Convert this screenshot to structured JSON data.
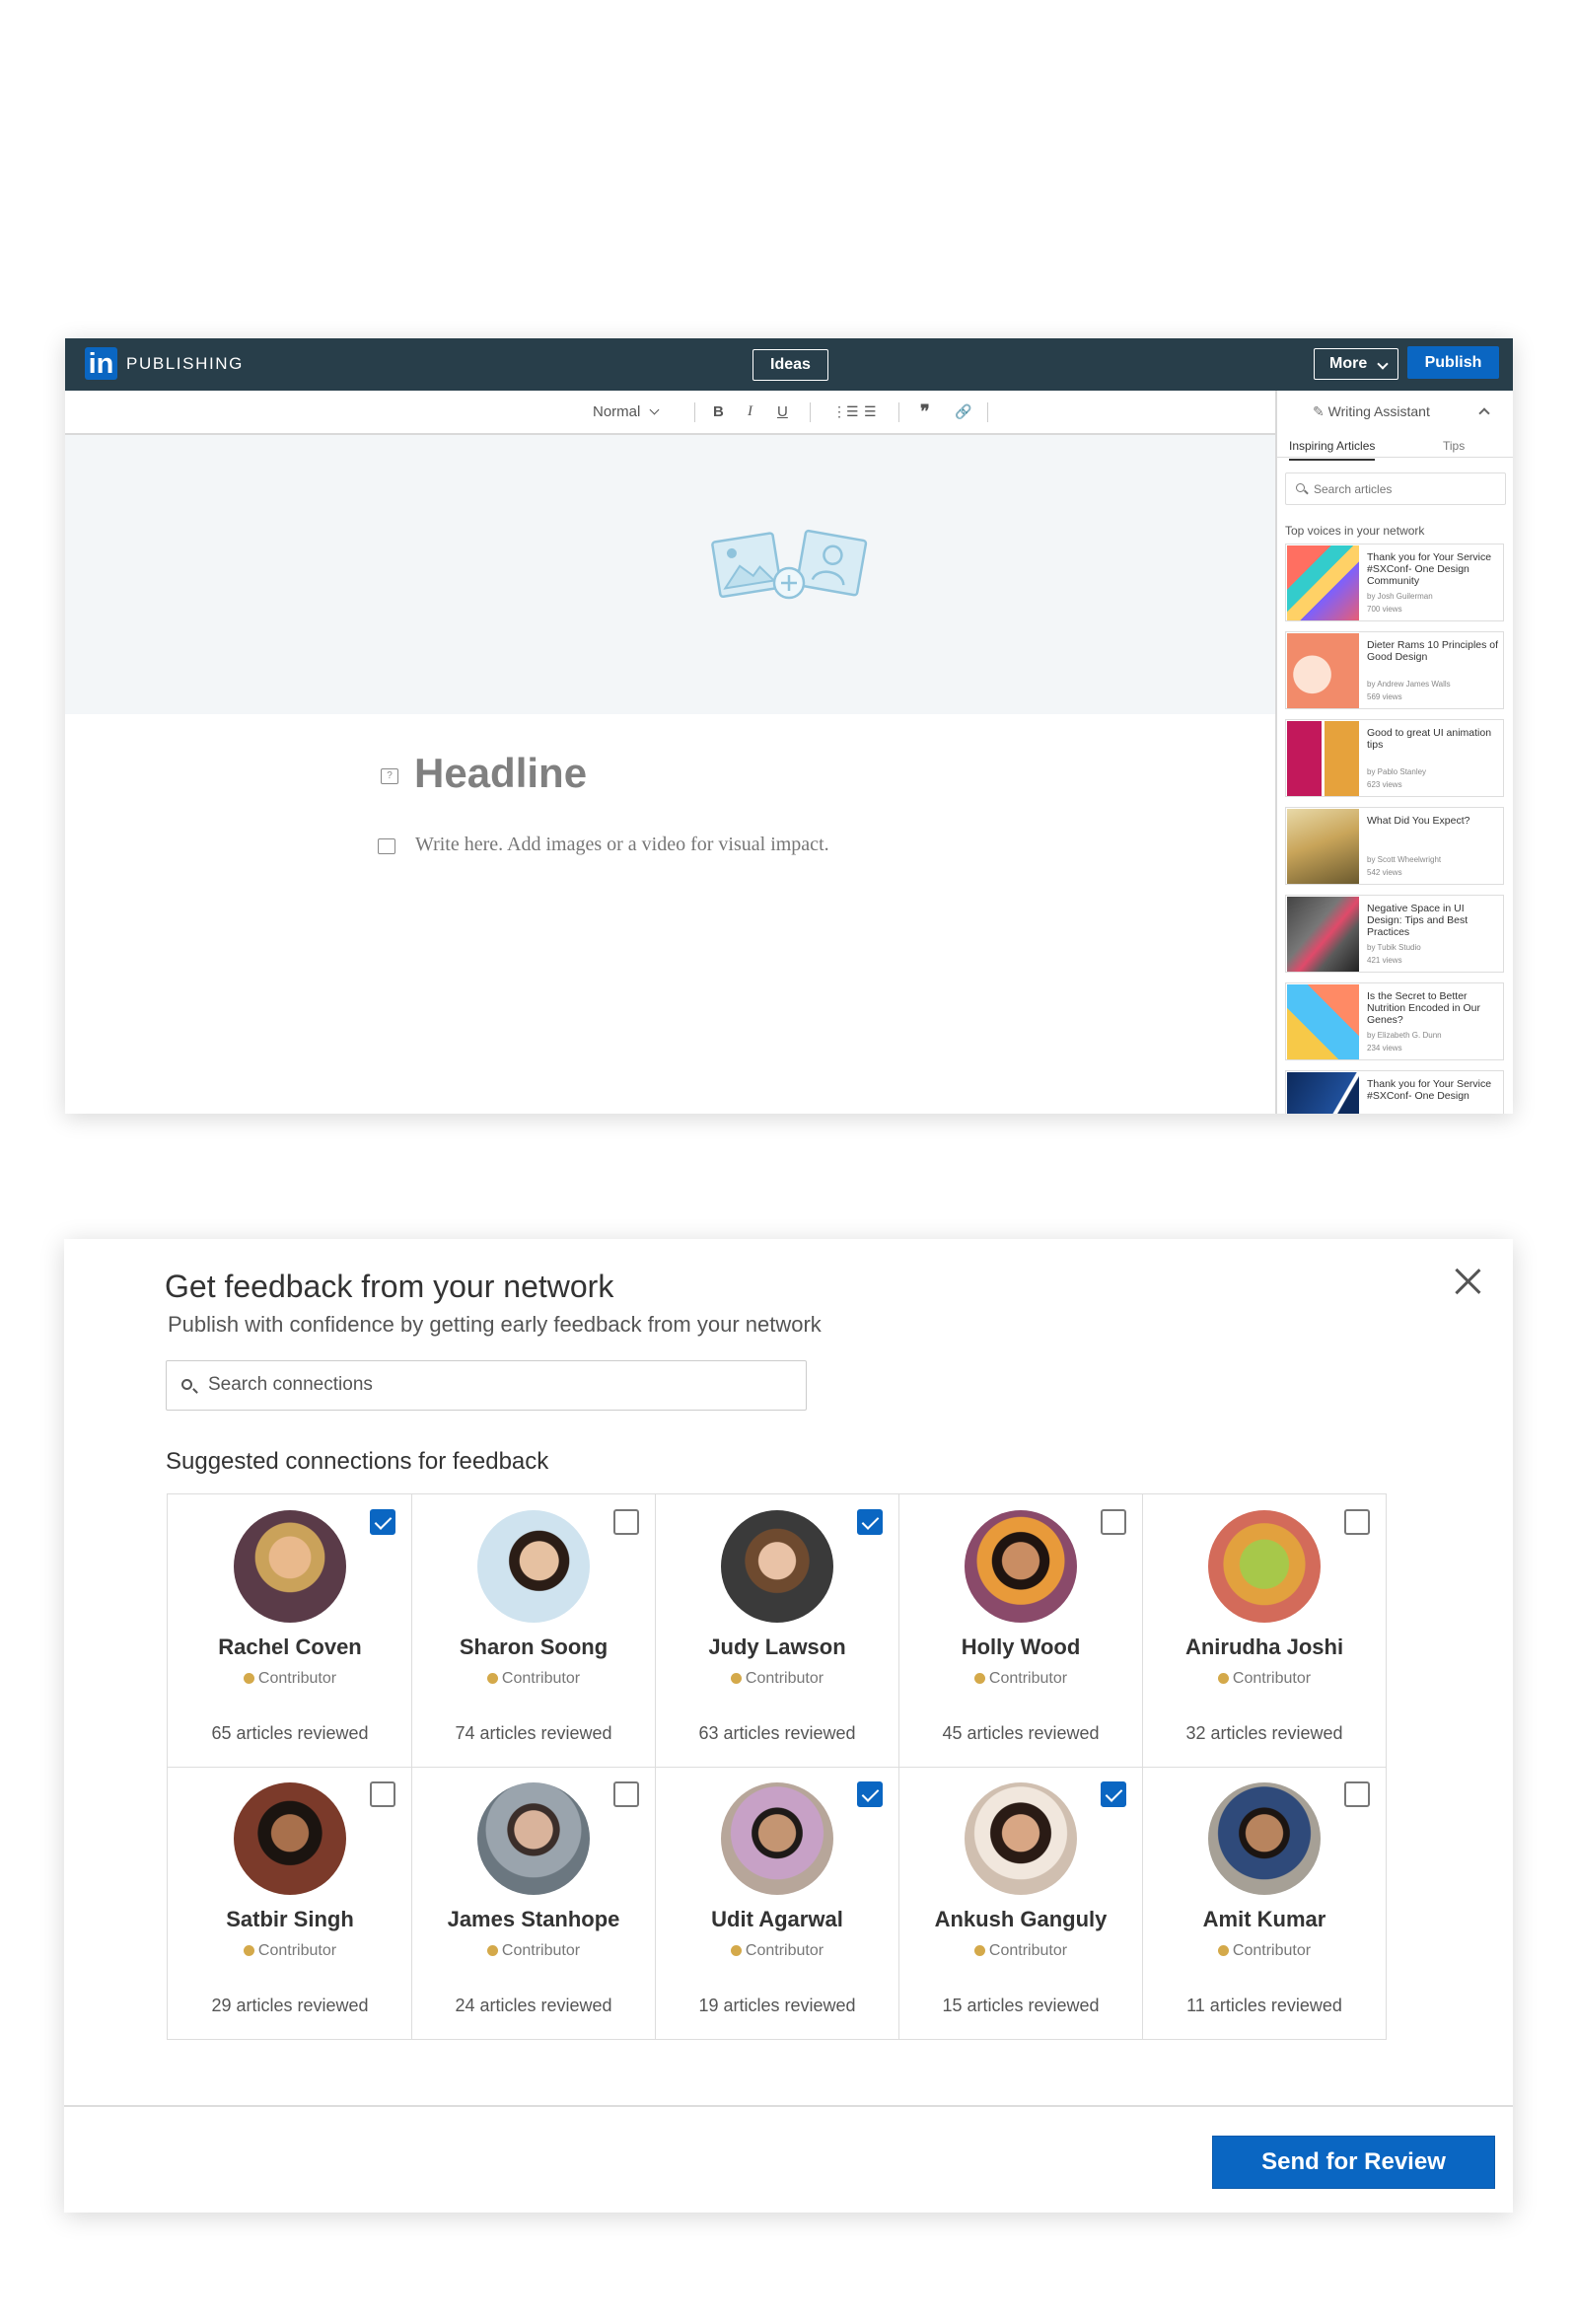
{
  "editor": {
    "brand": "PUBLISHING",
    "logo": "in",
    "ideas_label": "Ideas",
    "more_label": "More",
    "publish_label": "Publish",
    "toolbar": {
      "style_select": "Normal"
    },
    "headline_placeholder": "Headline",
    "body_placeholder": "Write here. Add images or a video for visual impact."
  },
  "sidebar": {
    "title": "Writing Assistant",
    "tabs": [
      "Inspiring Articles",
      "Tips"
    ],
    "search_placeholder": "Search articles",
    "section_title": "Top voices in your network",
    "articles": [
      {
        "title": "Thank you for Your Service #SXConf- One Design Community",
        "author": "by Josh Guilerman",
        "views": "700 views"
      },
      {
        "title": "Dieter Rams 10 Principles of Good Design",
        "author": "by Andrew James Walls",
        "views": "569 views"
      },
      {
        "title": "Good to great UI animation tips",
        "author": "by Pablo Stanley",
        "views": "623 views"
      },
      {
        "title": "What Did You Expect?",
        "author": "by Scott Wheelwright",
        "views": "542 views"
      },
      {
        "title": "Negative Space in UI Design: Tips and Best Practices",
        "author": "by Tubik Studio",
        "views": "421 views"
      },
      {
        "title": "Is the Secret to Better Nutrition Encoded in Our Genes?",
        "author": "by Elizabeth G. Dunn",
        "views": "234 views"
      },
      {
        "title": "Thank you for Your Service #SXConf- One Design",
        "author": "",
        "views": ""
      }
    ]
  },
  "modal": {
    "title": "Get feedback from your network",
    "subtitle": "Publish with confidence by getting early feedback from your network",
    "search_placeholder": "Search connections",
    "section_title": "Suggested connections for feedback",
    "send_label": "Send for Review",
    "people": [
      {
        "name": "Rachel Coven",
        "role": "Contributor",
        "count": "65 articles reviewed",
        "checked": true
      },
      {
        "name": "Sharon Soong",
        "role": "Contributor",
        "count": "74 articles reviewed",
        "checked": false
      },
      {
        "name": "Judy Lawson",
        "role": "Contributor",
        "count": "63 articles reviewed",
        "checked": true
      },
      {
        "name": "Holly Wood",
        "role": "Contributor",
        "count": "45 articles reviewed",
        "checked": false
      },
      {
        "name": "Anirudha Joshi",
        "role": "Contributor",
        "count": "32 articles reviewed",
        "checked": false
      },
      {
        "name": "Satbir Singh",
        "role": "Contributor",
        "count": "29 articles reviewed",
        "checked": false
      },
      {
        "name": "James Stanhope",
        "role": "Contributor",
        "count": "24 articles reviewed",
        "checked": false
      },
      {
        "name": "Udit Agarwal",
        "role": "Contributor",
        "count": "19 articles reviewed",
        "checked": true
      },
      {
        "name": "Ankush Ganguly",
        "role": "Contributor",
        "count": "15 articles reviewed",
        "checked": true
      },
      {
        "name": "Amit Kumar",
        "role": "Contributor",
        "count": "11 articles reviewed",
        "checked": false
      }
    ]
  },
  "colors": {
    "topbar": "#283e4a",
    "accent": "#0a66c2",
    "canvas": "#f3f6f8"
  }
}
